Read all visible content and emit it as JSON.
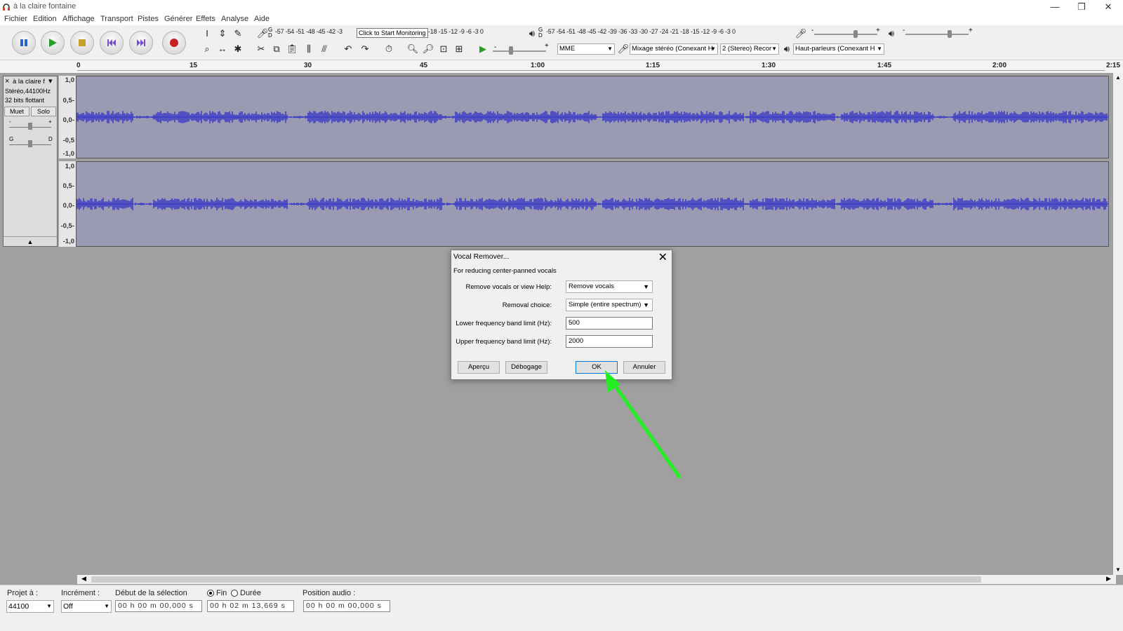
{
  "window": {
    "title": "à la claire fontaine",
    "minimize": "—",
    "restore": "❐",
    "close": "✕"
  },
  "menu": [
    {
      "label": "Fichier"
    },
    {
      "label": "Edition"
    },
    {
      "label": "Affichage"
    },
    {
      "label": "Transport"
    },
    {
      "label": "Pistes"
    },
    {
      "label": "Générer"
    },
    {
      "label": "Effets"
    },
    {
      "label": "Analyse"
    },
    {
      "label": "Aide"
    }
  ],
  "toolbar": {
    "record_meter_scale": "-57 -54 -51 -48 -45 -42 -3",
    "record_meter_scale_right": "-18 -15 -12 -9 -6 -3 0",
    "monitor_tooltip": "Click to Start Monitoring",
    "playback_meter_scale": "-57 -54 -51 -48 -45 -42 -39 -36 -33 -30 -27 -24 -21 -18 -15 -12 -9 -6 -3 0",
    "host": "MME",
    "recording_device": "Mixage stéréo (Conexant H",
    "recording_channels": "2 (Stereo) Recor",
    "playback_device": "Haut-parleurs (Conexant H",
    "meter_lr_top": "G",
    "meter_lr_bottom": "D",
    "slider_minus": "-",
    "slider_plus": "+",
    "gain_left": "G",
    "gain_right": "D"
  },
  "ruler": {
    "labels": [
      "0",
      "15",
      "30",
      "45",
      "1:00",
      "1:15",
      "1:30",
      "1:45",
      "2:00",
      "2:15"
    ]
  },
  "track": {
    "name": "à la claire f",
    "info1": "Stéréo,44100Hz",
    "info2": "32 bits flottant",
    "mute": "Muet",
    "solo": "Solo",
    "close": "×",
    "menu_arrow": "▾",
    "collapse": "▲",
    "y_labels_top": [
      "1,0",
      "0,5-",
      "0,0-",
      "-0,5",
      "-1,0"
    ],
    "y_labels_bottom": [
      "1,0",
      "0,5-",
      "0,0-",
      "-0,5-",
      "-1,0"
    ]
  },
  "status": {
    "project_rate_label": "Projet à :",
    "project_rate": "44100",
    "snap_label": "Incrément :",
    "snap_value": "Off",
    "selection_start_label": "Début de la sélection",
    "end_label": "Fin",
    "length_label": "Durée",
    "selection_start": "00 h 00 m 00,000 s",
    "selection_end": "00 h 02 m 13,669 s",
    "audio_position_label": "Position audio :",
    "audio_position": "00 h 00 m 00,000 s"
  },
  "dialog": {
    "title": "Vocal Remover...",
    "close": "✕",
    "description": "For reducing center-panned vocals",
    "field1_label": "Remove vocals or view Help:",
    "field1_value": "Remove vocals",
    "field2_label": "Removal choice:",
    "field2_value": "Simple (entire spectrum)",
    "field3_label": "Lower frequency band limit (Hz):",
    "field3_value": "500",
    "field4_label": "Upper frequency band limit (Hz):",
    "field4_value": "2000",
    "preview": "Aperçu",
    "debug": "Débogage",
    "ok": "OK",
    "cancel": "Annuler"
  },
  "colors": {
    "waveform": "#3232c8",
    "waveform_bg": "#9a9ab2",
    "annotation_arrow": "#22ee22"
  }
}
